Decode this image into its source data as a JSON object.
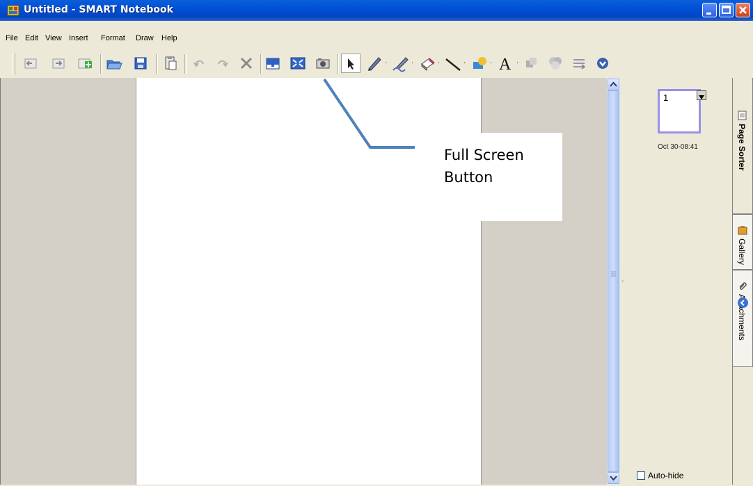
{
  "window": {
    "title": "Untitled - SMART Notebook"
  },
  "menu": {
    "items": [
      {
        "label": "File"
      },
      {
        "label": "Edit"
      },
      {
        "label": "View"
      },
      {
        "label": "Insert"
      },
      {
        "label": "Format"
      },
      {
        "label": "Draw"
      },
      {
        "label": "Help"
      }
    ]
  },
  "toolbar": {
    "buttons": [
      {
        "icon": "previous-page-icon"
      },
      {
        "icon": "next-page-icon"
      },
      {
        "icon": "add-page-icon"
      },
      {
        "icon": "open-folder-icon"
      },
      {
        "icon": "save-icon"
      },
      {
        "icon": "paste-icon"
      },
      {
        "icon": "undo-icon"
      },
      {
        "icon": "redo-icon"
      },
      {
        "icon": "delete-icon"
      },
      {
        "icon": "screen-shade-icon"
      },
      {
        "icon": "full-screen-icon"
      },
      {
        "icon": "screen-capture-icon"
      },
      {
        "icon": "select-pointer-icon"
      },
      {
        "icon": "pen-icon"
      },
      {
        "icon": "creative-pen-icon"
      },
      {
        "icon": "eraser-icon"
      },
      {
        "icon": "line-icon"
      },
      {
        "icon": "shapes-icon"
      },
      {
        "icon": "text-icon"
      },
      {
        "icon": "fill-icon"
      },
      {
        "icon": "properties-icon"
      },
      {
        "icon": "move-toolbar-icon"
      },
      {
        "icon": "more-icon"
      }
    ]
  },
  "page_sorter": {
    "thumbnail_number": "1",
    "thumbnail_date": "Oct 30-08:41",
    "auto_hide_label": "Auto-hide",
    "auto_hide_checked": false
  },
  "tabs": [
    {
      "label": "Page Sorter",
      "active": true,
      "icon": "page-sorter-icon"
    },
    {
      "label": "Gallery",
      "active": false,
      "icon": "gallery-icon"
    },
    {
      "label": "Attachments",
      "active": false,
      "icon": "attachments-icon"
    }
  ],
  "callout": {
    "line1": "Full Screen",
    "line2": "Button",
    "line_color": "#4f81bd"
  },
  "colors": {
    "titlebar": "#0050d8",
    "chrome": "#ece9d8",
    "workspace": "#d4d0c8",
    "thumbnail_border": "#9d8fe8"
  }
}
